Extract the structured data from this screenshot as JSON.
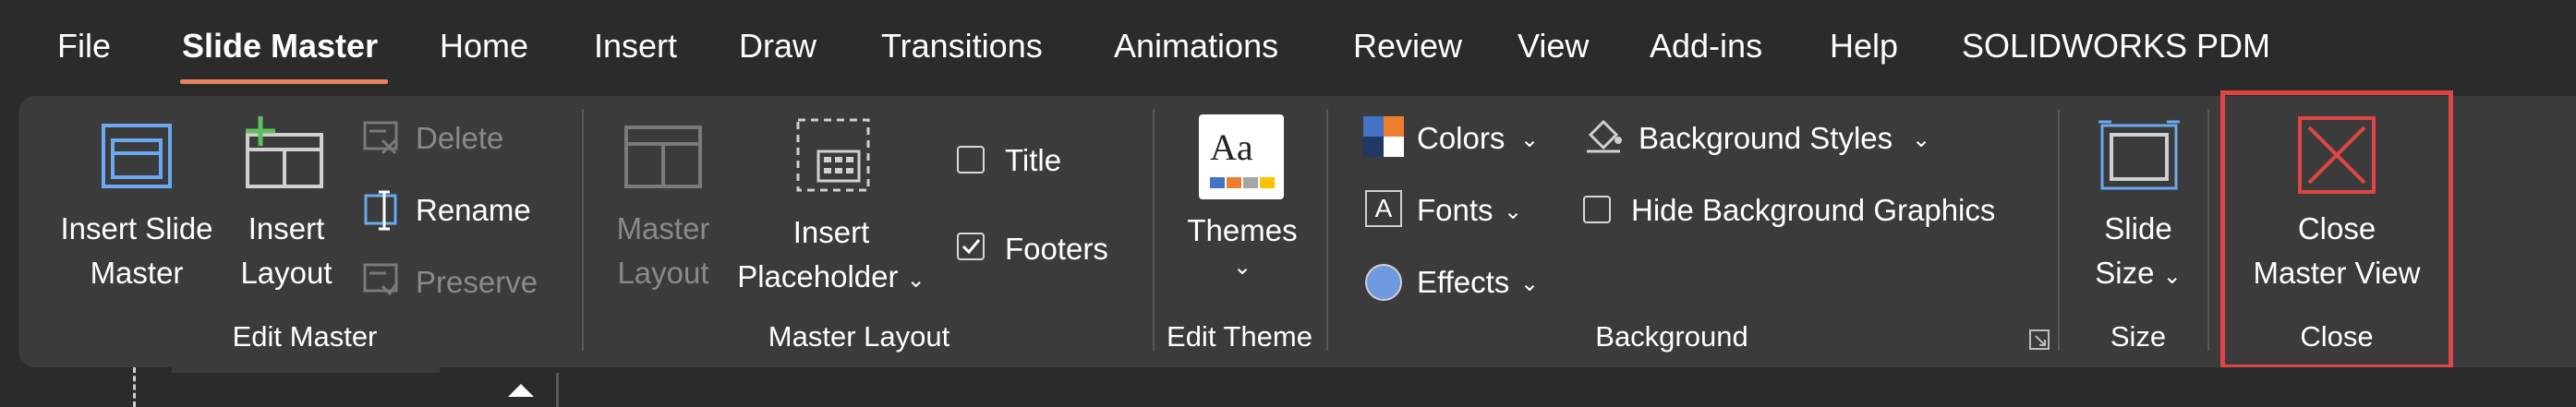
{
  "menu": {
    "tabs": [
      "File",
      "Slide Master",
      "Home",
      "Insert",
      "Draw",
      "Transitions",
      "Animations",
      "Review",
      "View",
      "Add-ins",
      "Help",
      "SOLIDWORKS PDM"
    ],
    "active_tab": "Slide Master",
    "accent_color": "#e8825d"
  },
  "edit_master": {
    "group_label": "Edit Master",
    "insert_slide_master": [
      "Insert Slide",
      "Master"
    ],
    "insert_layout": [
      "Insert",
      "Layout"
    ],
    "delete": "Delete",
    "rename": "Rename",
    "preserve": "Preserve"
  },
  "master_layout": {
    "group_label": "Master Layout",
    "master_layout_btn": [
      "Master",
      "Layout"
    ],
    "insert_placeholder": [
      "Insert",
      "Placeholder"
    ],
    "title_label": "Title",
    "title_checked": false,
    "footers_label": "Footers",
    "footers_checked": true
  },
  "edit_theme": {
    "group_label": "Edit Theme",
    "themes": "Themes",
    "themes_icon_text": "Aa"
  },
  "background": {
    "group_label": "Background",
    "colors": "Colors",
    "fonts": "Fonts",
    "fonts_icon_text": "A",
    "effects": "Effects",
    "background_styles": "Background Styles",
    "hide_background_graphics": "Hide Background Graphics",
    "hide_checked": false
  },
  "size": {
    "group_label": "Size",
    "slide_size": [
      "Slide",
      "Size"
    ]
  },
  "close": {
    "group_label": "Close",
    "close_master_view": [
      "Close",
      "Master View"
    ],
    "highlight_color": "#e04545"
  }
}
